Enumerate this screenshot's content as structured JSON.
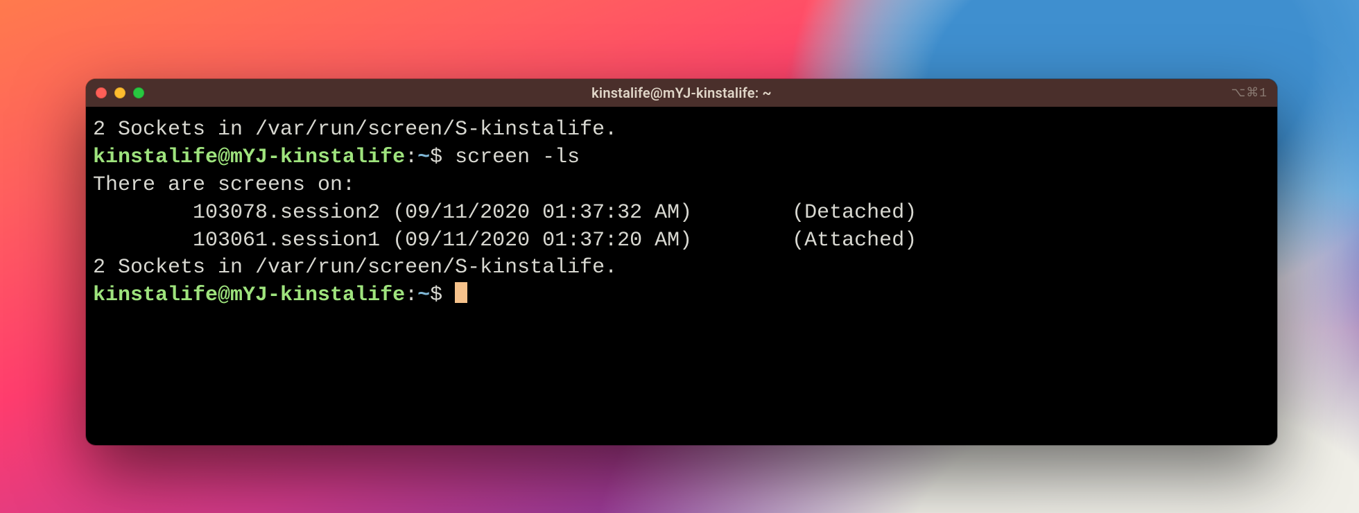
{
  "window": {
    "title": "kinstalife@mYJ-kinstalife: ~",
    "right_indicator": "⌥⌘1"
  },
  "prompt": {
    "user_host": "kinstalife@mYJ-kinstalife",
    "separator": ":",
    "path": "~",
    "symbol": "$"
  },
  "lines": {
    "l0_output": "2 Sockets in /var/run/screen/S-kinstalife.",
    "l1_command": "screen -ls",
    "l2_output": "There are screens on:",
    "l3_output": "        103078.session2 (09/11/2020 01:37:32 AM)        (Detached)",
    "l4_output": "        103061.session1 (09/11/2020 01:37:20 AM)        (Attached)",
    "l5_output": "2 Sockets in /var/run/screen/S-kinstalife."
  }
}
